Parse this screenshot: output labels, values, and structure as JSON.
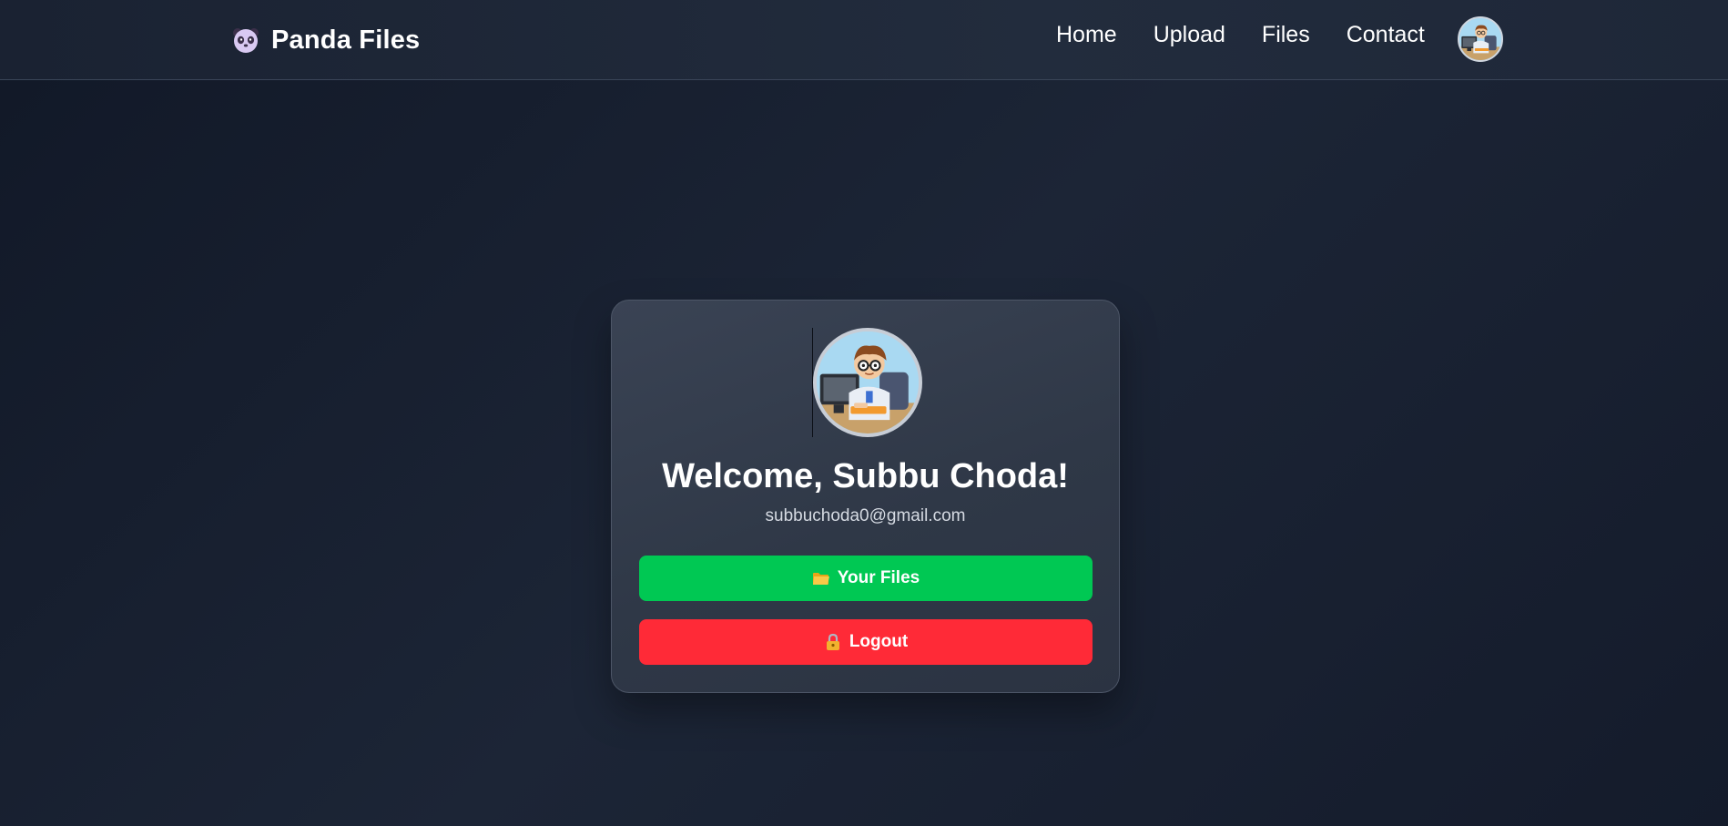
{
  "navbar": {
    "brand_icon": "panda-icon",
    "brand_name": "Panda Files",
    "links": [
      {
        "label": "Home"
      },
      {
        "label": "Upload"
      },
      {
        "label": "Files"
      },
      {
        "label": "Contact"
      }
    ],
    "avatar_icon": "user-avatar"
  },
  "profile": {
    "avatar_icon": "user-avatar",
    "welcome": "Welcome, Subbu Choda!",
    "email": "subbuchoda0@gmail.com",
    "files_button": {
      "icon": "folder-icon",
      "label": "Your Files"
    },
    "logout_button": {
      "icon": "lock-icon",
      "label": "Logout"
    }
  },
  "colors": {
    "background": "#111827",
    "card": "#343d4d",
    "files_button": "#00c853",
    "logout_button": "#ff2a37"
  }
}
